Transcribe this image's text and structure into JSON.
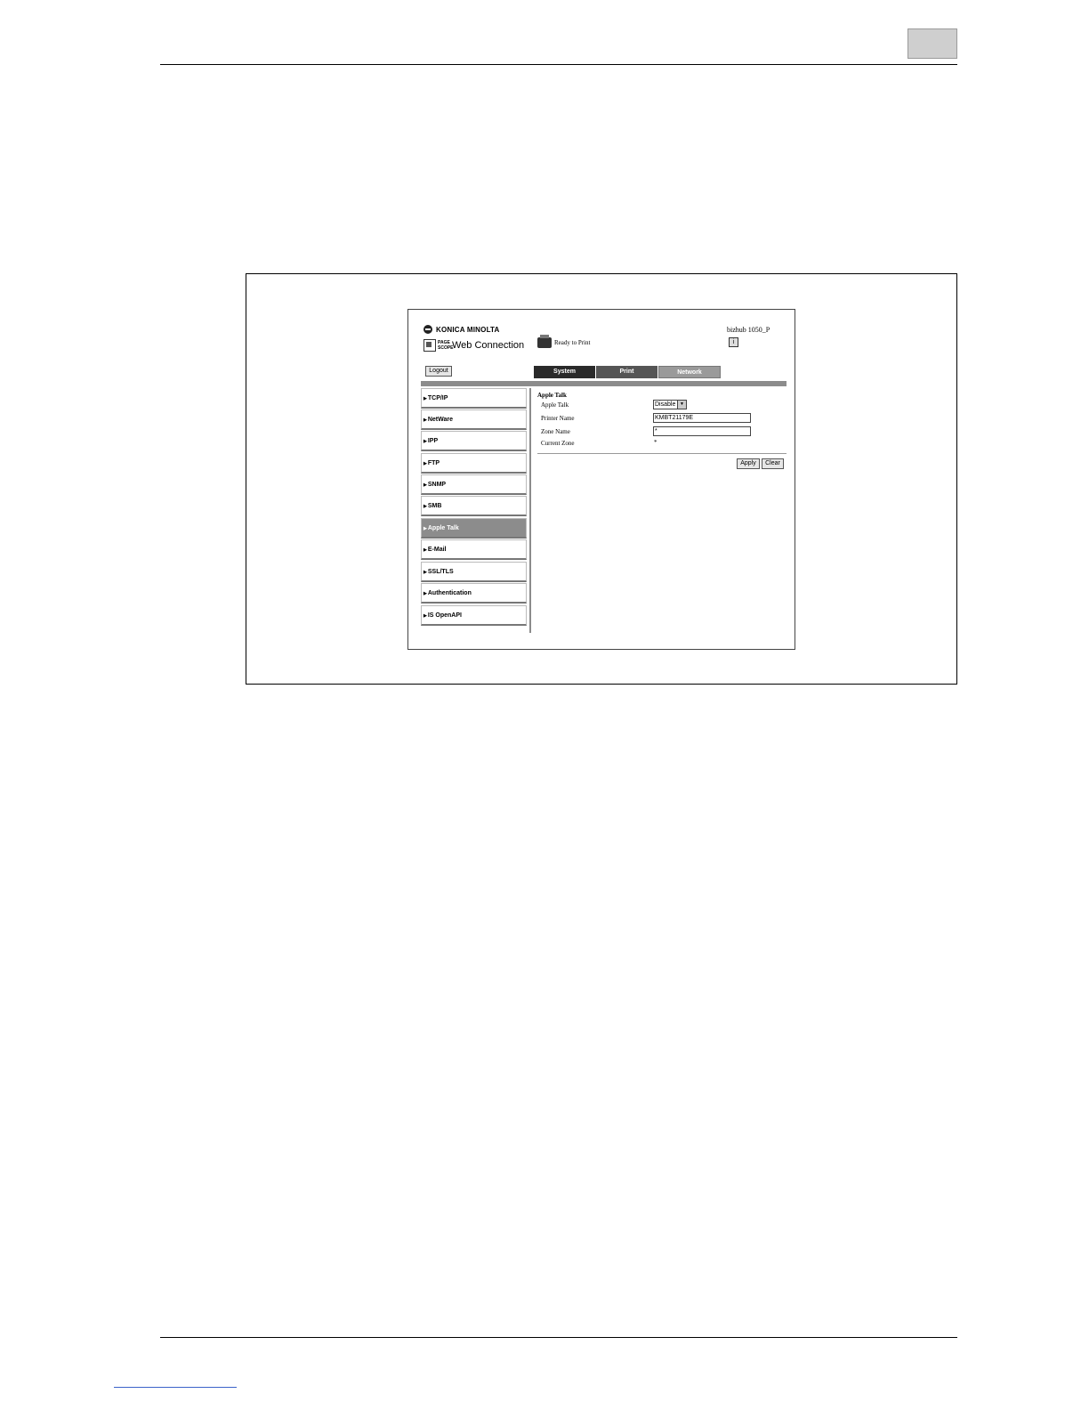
{
  "header": {
    "brand": "KONICA MINOLTA",
    "pagescope": "PAGE SCOPE",
    "product": "Web Connection",
    "status": "Ready to Print",
    "device": "bizhub 1050_P",
    "logout": "Logout",
    "help_icon": "help-icon"
  },
  "tabs": [
    "System",
    "Print",
    "Network"
  ],
  "active_tab": "Network",
  "sidebar": [
    {
      "label": "TCP/IP"
    },
    {
      "label": "NetWare"
    },
    {
      "label": "IPP"
    },
    {
      "label": "FTP"
    },
    {
      "label": "SNMP"
    },
    {
      "label": "SMB"
    },
    {
      "label": "Apple Talk",
      "active": true
    },
    {
      "label": "E-Mail"
    },
    {
      "label": "SSL/TLS"
    },
    {
      "label": "Authentication"
    },
    {
      "label": "IS OpenAPI"
    }
  ],
  "content": {
    "title": "Apple Talk",
    "apple_talk_label": "Apple Talk",
    "apple_talk_value": "Disable",
    "printer_name_label": "Printer Name",
    "printer_name_value": "KMBT21179E",
    "zone_name_label": "Zone Name",
    "zone_name_value": "*",
    "current_zone_label": "Current Zone",
    "current_zone_value": "*",
    "apply": "Apply",
    "clear": "Clear"
  }
}
